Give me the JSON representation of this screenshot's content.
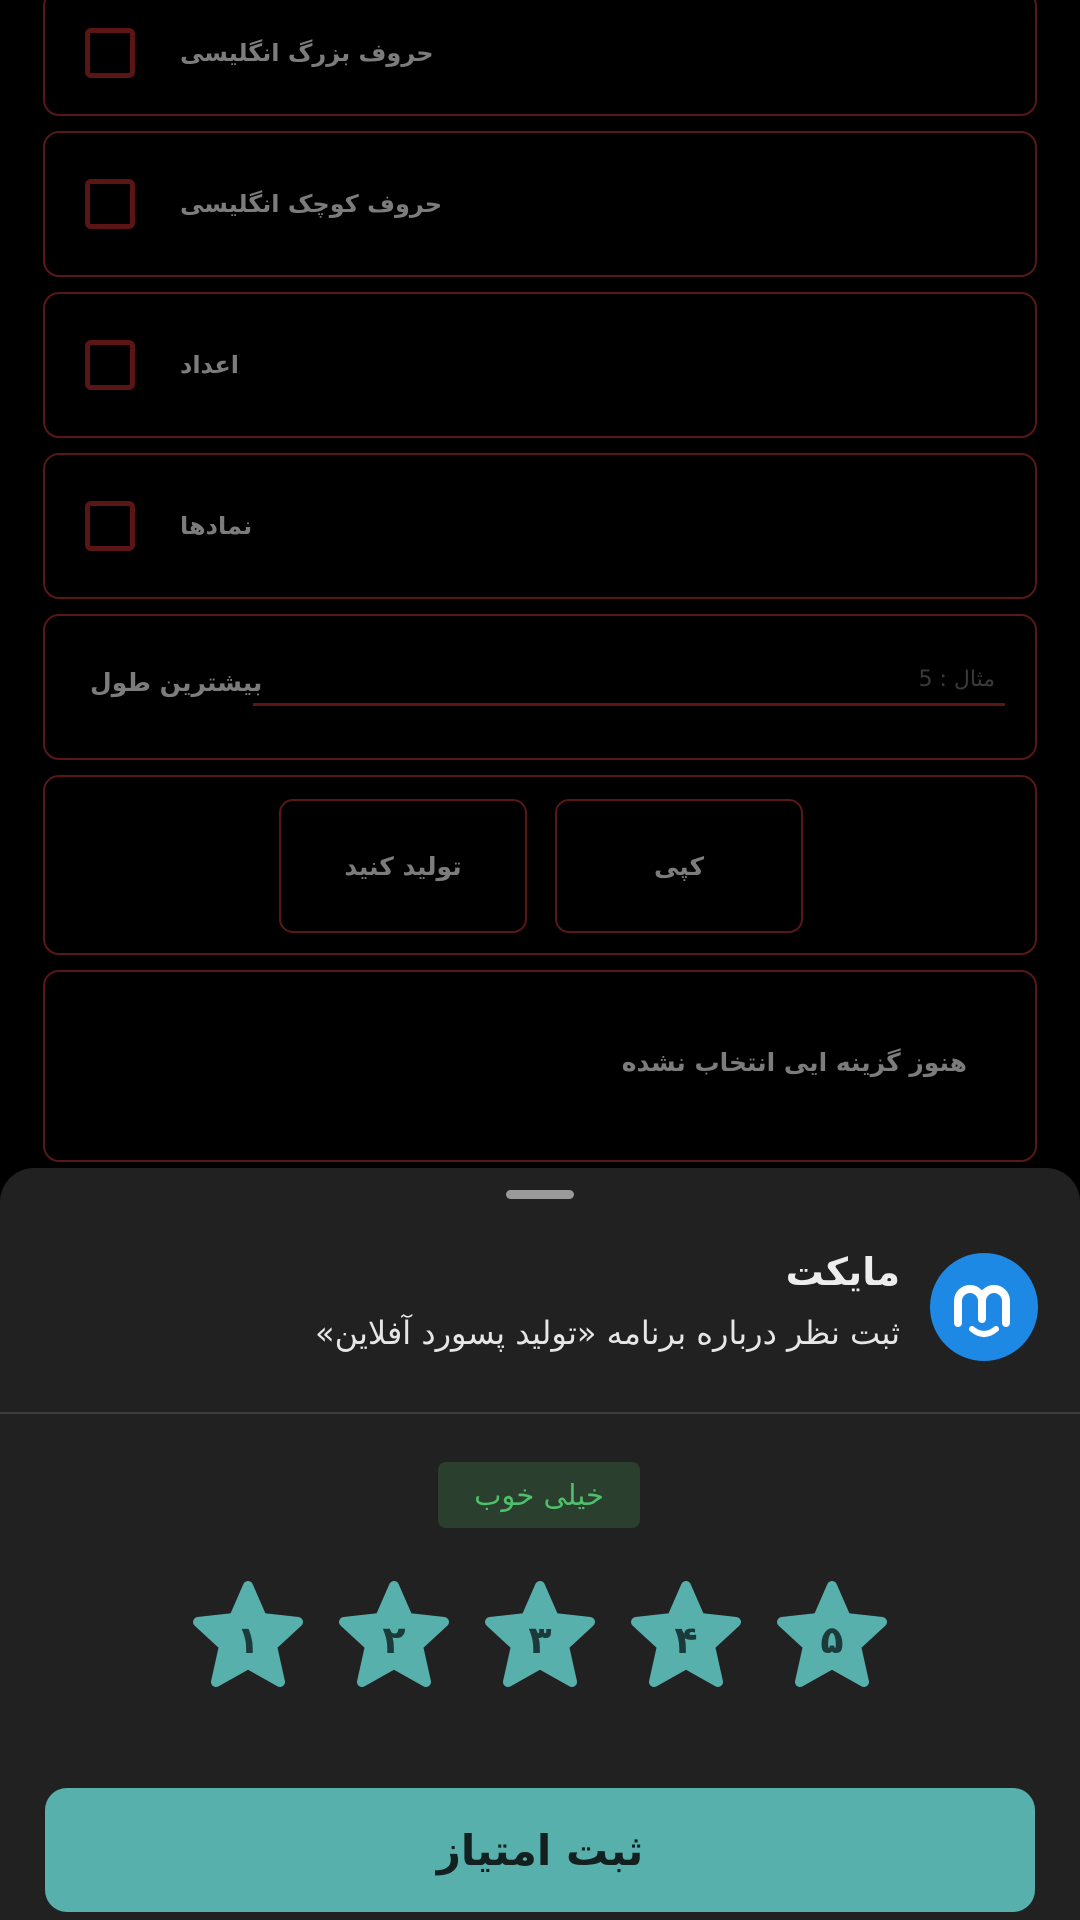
{
  "options": [
    {
      "label": "حروف بزرگ انگلیسی",
      "checked": false
    },
    {
      "label": "حروف کوچک انگلیسی",
      "checked": false
    },
    {
      "label": "اعداد",
      "checked": false
    },
    {
      "label": "نمادها",
      "checked": false
    }
  ],
  "length": {
    "label": "بیشترین طول",
    "placeholder": "مثال : 5",
    "value": ""
  },
  "actions": {
    "generate_label": "تولید کنید",
    "copy_label": "کپی"
  },
  "result": {
    "text": "هنوز گزینه ایی انتخاب نشده"
  },
  "sheet": {
    "app_name": "مایکت",
    "subtitle": "ثبت نظر درباره برنامه «تولید پسورد آفلاین»",
    "rating_text": "خیلی خوب",
    "stars": [
      "۱",
      "۲",
      "۳",
      "۴",
      "۵"
    ],
    "submit_label": "ثبت امتیاز"
  },
  "colors": {
    "accent": "#58b0ad",
    "star": "#58b0ad",
    "card_border": "#5a1717",
    "rating_text": "#4fbf6b",
    "logo": "#1e88e5",
    "sheet_bg": "#212121"
  },
  "icons": {
    "logo": "myket-logo-icon",
    "rating": "star-icon"
  }
}
